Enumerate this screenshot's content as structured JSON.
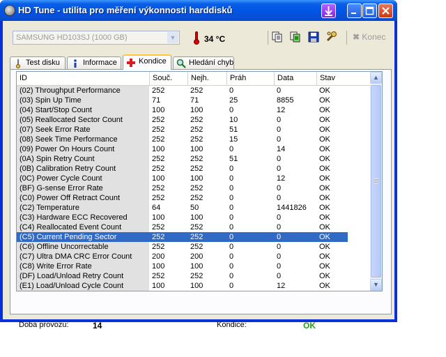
{
  "window": {
    "title": "HD Tune - utilita pro měření výkonnosti harddisků"
  },
  "toolbar": {
    "drive": "SAMSUNG HD103SJ (1000 GB)",
    "temperature": "34 °C",
    "exit_label": "Konec",
    "icons": [
      "copy-text-icon",
      "copy-screenshot-icon",
      "save-icon",
      "options-icon"
    ]
  },
  "tabs": [
    {
      "label": "Test disku",
      "icon": "benchmark-icon"
    },
    {
      "label": "Informace",
      "icon": "info-icon"
    },
    {
      "label": "Kondice",
      "icon": "health-icon",
      "active": true
    },
    {
      "label": "Hledání chyb",
      "icon": "error-scan-icon"
    }
  ],
  "table": {
    "columns": [
      "ID",
      "Souč.",
      "Nejh.",
      "Práh",
      "Data",
      "Stav"
    ],
    "rows": [
      [
        "(02) Throughput Performance",
        "252",
        "252",
        "0",
        "0",
        "OK"
      ],
      [
        "(03) Spin Up Time",
        "71",
        "71",
        "25",
        "8855",
        "OK"
      ],
      [
        "(04) Start/Stop Count",
        "100",
        "100",
        "0",
        "12",
        "OK"
      ],
      [
        "(05) Reallocated Sector Count",
        "252",
        "252",
        "10",
        "0",
        "OK"
      ],
      [
        "(07) Seek Error Rate",
        "252",
        "252",
        "51",
        "0",
        "OK"
      ],
      [
        "(08) Seek Time Performance",
        "252",
        "252",
        "15",
        "0",
        "OK"
      ],
      [
        "(09) Power On Hours Count",
        "100",
        "100",
        "0",
        "14",
        "OK"
      ],
      [
        "(0A) Spin Retry Count",
        "252",
        "252",
        "51",
        "0",
        "OK"
      ],
      [
        "(0B) Calibration Retry Count",
        "252",
        "252",
        "0",
        "0",
        "OK"
      ],
      [
        "(0C) Power Cycle Count",
        "100",
        "100",
        "0",
        "12",
        "OK"
      ],
      [
        "(BF) G-sense Error Rate",
        "252",
        "252",
        "0",
        "0",
        "OK"
      ],
      [
        "(C0) Power Off Retract Count",
        "252",
        "252",
        "0",
        "0",
        "OK"
      ],
      [
        "(C2) Temperature",
        "64",
        "50",
        "0",
        "1441826",
        "OK"
      ],
      [
        "(C3) Hardware ECC Recovered",
        "100",
        "100",
        "0",
        "0",
        "OK"
      ],
      [
        "(C4) Reallocated Event Count",
        "252",
        "252",
        "0",
        "0",
        "OK"
      ],
      [
        "(C5) Current Pending Sector",
        "252",
        "252",
        "0",
        "0",
        "OK"
      ],
      [
        "(C6) Offline Uncorrectable",
        "252",
        "252",
        "0",
        "0",
        "OK"
      ],
      [
        "(C7) Ultra DMA CRC Error Count",
        "200",
        "200",
        "0",
        "0",
        "OK"
      ],
      [
        "(C8) Write Error Rate",
        "100",
        "100",
        "0",
        "0",
        "OK"
      ],
      [
        "(DF) Load/Unload Retry Count",
        "252",
        "252",
        "0",
        "0",
        "OK"
      ],
      [
        "(E1) Load/Unload Cycle Count",
        "100",
        "100",
        "0",
        "12",
        "OK"
      ]
    ],
    "selected_row": "(C5) Current Pending Sector"
  },
  "status": {
    "uptime_label": "Doba provozu:",
    "uptime_value": "14",
    "health_label": "Kondice:",
    "health_value": "OK"
  },
  "colors": {
    "health_ok": "#22a01c",
    "selection": "#316ac5"
  }
}
